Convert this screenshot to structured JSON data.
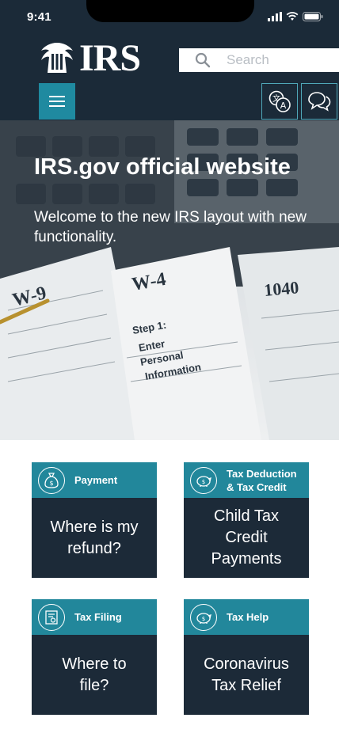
{
  "status_bar": {
    "time": "9:41"
  },
  "header": {
    "logo_text": "IRS",
    "search_placeholder": "Search"
  },
  "hero": {
    "title": "IRS.gov official website",
    "subtitle": "Welcome to the new IRS layout with new functionality."
  },
  "cards": [
    {
      "category": "Payment",
      "label": "Where is my refund?",
      "icon": "money-bag-icon"
    },
    {
      "category": "Tax Deduction & Tax Credit",
      "label": "Child Tax Credit Payments",
      "icon": "piggy-bank-icon"
    },
    {
      "category": "Tax Filing",
      "label": "Where to file?",
      "icon": "tax-form-icon"
    },
    {
      "category": "Tax Help",
      "label": "Coronavirus Tax Relief",
      "icon": "piggy-bank-icon"
    }
  ],
  "colors": {
    "header_bg": "#1b2a38",
    "accent": "#22879b",
    "card_body": "#1c2a38"
  }
}
